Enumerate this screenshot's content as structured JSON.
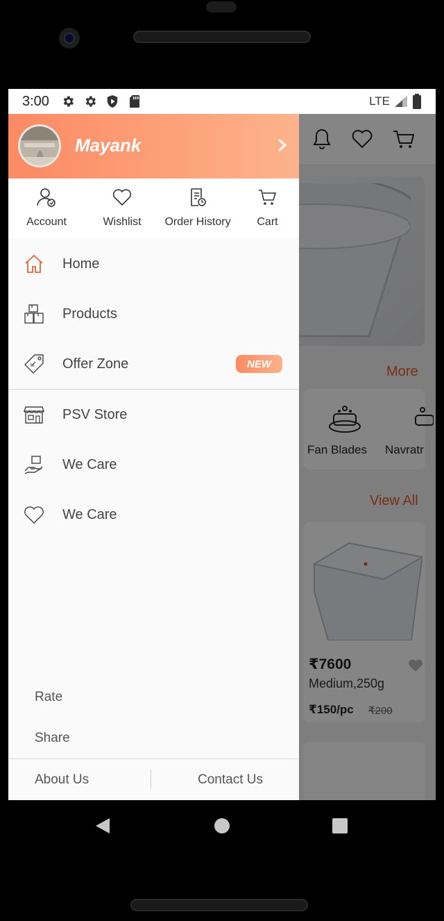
{
  "status_bar": {
    "time": "3:00",
    "network": "LTE",
    "icons": [
      "gear-icon",
      "gear-icon",
      "shield-icon",
      "sd-card-icon"
    ]
  },
  "drawer": {
    "user_name": "Mayank",
    "quick_actions": [
      {
        "label": "Account",
        "icon": "user-icon"
      },
      {
        "label": "Wishlist",
        "icon": "heart-icon"
      },
      {
        "label": "Order History",
        "icon": "receipt-icon"
      },
      {
        "label": "Cart",
        "icon": "cart-icon"
      }
    ],
    "menu": [
      {
        "label": "Home",
        "icon": "home-icon"
      },
      {
        "label": "Products",
        "icon": "boxes-icon"
      },
      {
        "label": "Offer Zone",
        "icon": "tag-icon",
        "badge": "NEW"
      },
      {
        "label": "PSV Store",
        "icon": "store-icon"
      },
      {
        "label": "We Care",
        "icon": "hand-care-icon"
      },
      {
        "label": "We Care",
        "icon": "heart-icon"
      }
    ],
    "rate_label": "Rate",
    "share_label": "Share",
    "about_label": "About Us",
    "contact_label": "Contact Us"
  },
  "background": {
    "more_label": "More",
    "view_all_label": "View All",
    "categories": [
      "Fan Blades",
      "Navratr"
    ],
    "product": {
      "price": "₹7600",
      "name": "Medium,250g",
      "unit_price": "₹150/pc",
      "mrp": "₹200"
    }
  },
  "colors": {
    "accent": "#fb8a63",
    "accent_light": "#fdb38b",
    "link": "#e25a2c"
  }
}
